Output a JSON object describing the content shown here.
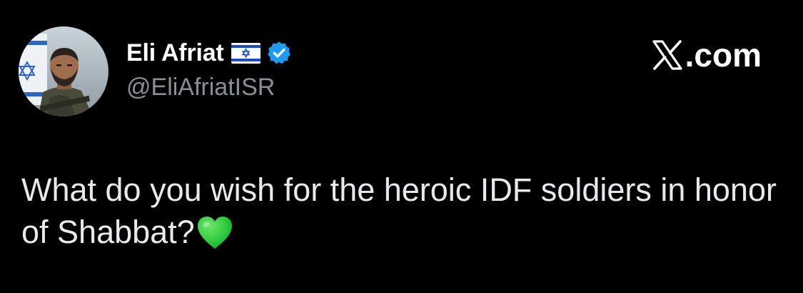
{
  "tweet": {
    "author": {
      "display_name": "Eli Afriat",
      "flag_icon": "israel-flag-icon",
      "verified_icon": "verified-badge-icon",
      "verified_color": "#1d9bf0",
      "handle": "@EliAfriatISR",
      "avatar": "profile-photo-soldier"
    },
    "brand": {
      "logo_icon": "x-logo-icon",
      "suffix": ".com"
    },
    "text": "What do you wish for the heroic IDF soldiers in honor of Shabbat?",
    "emoji": "green-heart-icon"
  },
  "colors": {
    "background": "#000000",
    "name": "#ffffff",
    "handle": "#8b8f94",
    "body_text": "#e7e9ea",
    "heart": "#2ecc40"
  }
}
